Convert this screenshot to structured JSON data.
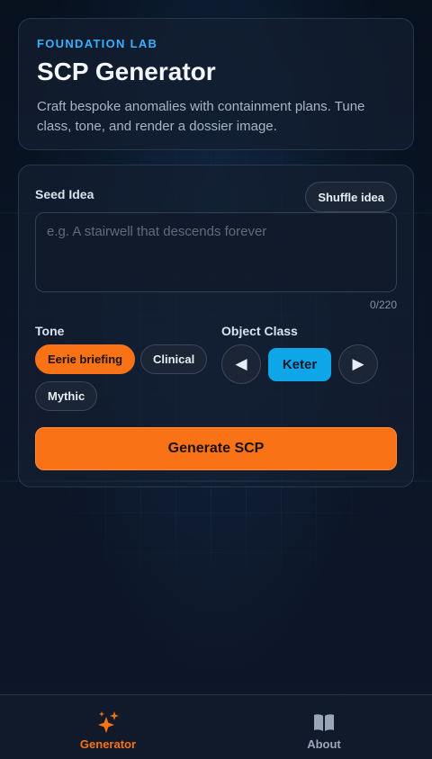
{
  "hero": {
    "eyebrow": "FOUNDATION LAB",
    "title": "SCP Generator",
    "description": "Craft bespoke anomalies with containment plans. Tune class, tone, and render a dossier image."
  },
  "form": {
    "seed_label": "Seed Idea",
    "shuffle_label": "Shuffle idea",
    "seed_placeholder": "e.g. A stairwell that descends forever",
    "seed_value": "",
    "char_count": "0/220",
    "tone_label": "Tone",
    "tones": [
      {
        "label": "Eerie briefing",
        "active": true
      },
      {
        "label": "Clinical",
        "active": false
      },
      {
        "label": "Mythic",
        "active": false
      }
    ],
    "class_label": "Object Class",
    "class_prev": "◀",
    "class_next": "▶",
    "class_value": "Keter",
    "generate_label": "Generate SCP"
  },
  "tabs": [
    {
      "label": "Generator",
      "icon": "sparkles-icon",
      "active": true
    },
    {
      "label": "About",
      "icon": "book-open-icon",
      "active": false
    }
  ],
  "colors": {
    "accent": "#f97316",
    "eyebrow": "#38b0ff",
    "class_pill": "#0ea5e9",
    "background": "#0a1220"
  }
}
